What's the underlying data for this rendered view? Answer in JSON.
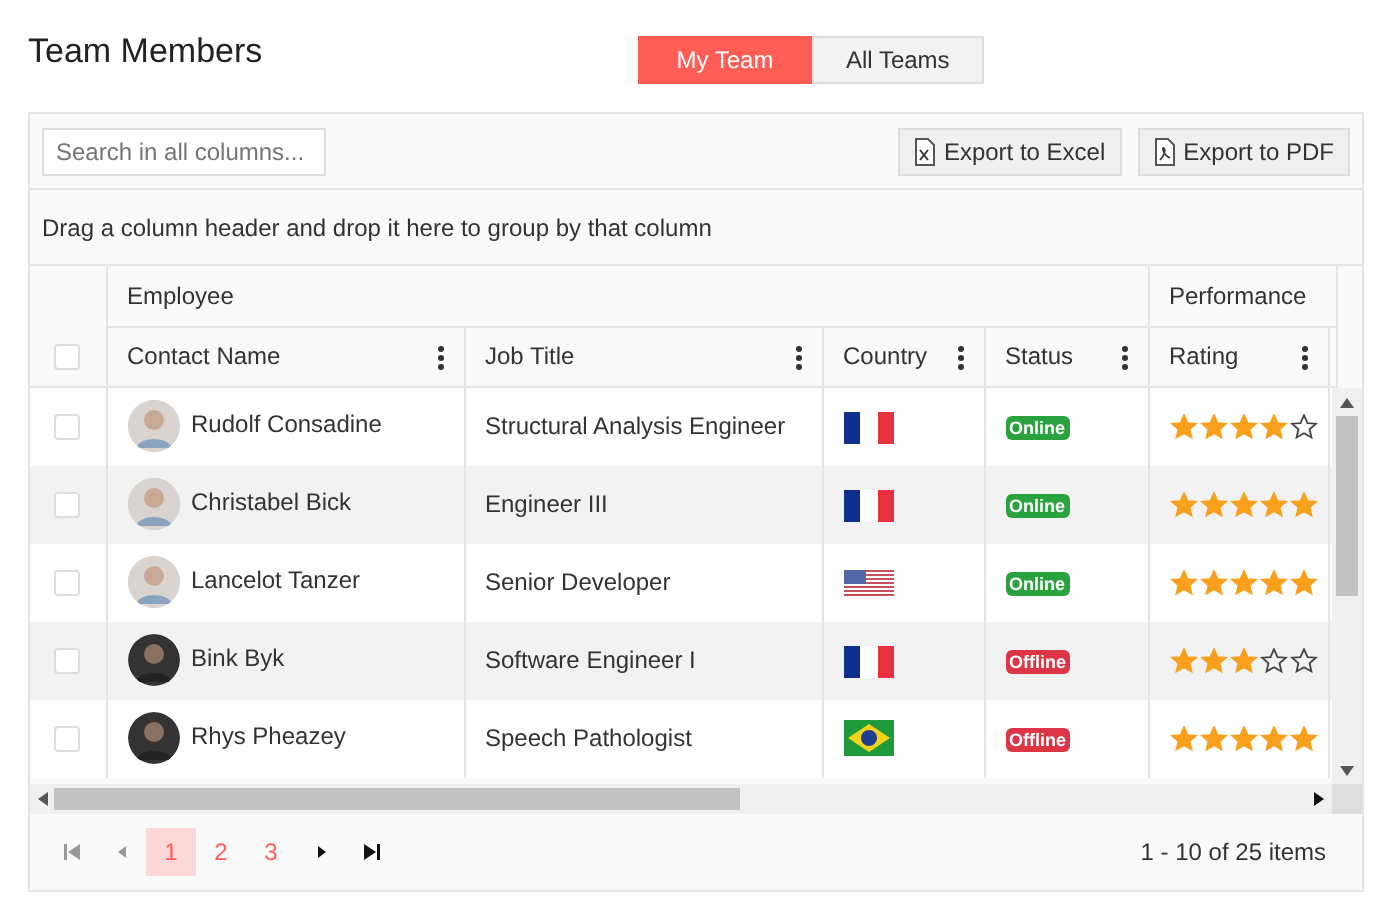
{
  "title": "Team Members",
  "view_toggle": [
    {
      "label": "My Team",
      "selected": true
    },
    {
      "label": "All Teams",
      "selected": false
    }
  ],
  "toolbar": {
    "search": {
      "placeholder": "Search in all columns..."
    },
    "buttons": [
      {
        "label": "Export to Excel",
        "kind": "excel"
      },
      {
        "label": "Export to PDF",
        "kind": "pdf"
      }
    ]
  },
  "group_panel": "Drag a column header and drop it here to group by that column",
  "column_groups": [
    "Employee",
    "Performance"
  ],
  "select_all": {
    "checked": false
  },
  "columns": [
    "Contact Name",
    "Job Title",
    "Country",
    "Status",
    "Rating"
  ],
  "rows": [
    {
      "checked": false,
      "name": "Rudolf Consadine",
      "job": "Structural Analysis Engineer",
      "kind": "france",
      "status": "Online",
      "color": "#2aa33f",
      "stars": 4
    },
    {
      "checked": false,
      "name": "Christabel Bick",
      "job": "Engineer III",
      "kind": "france",
      "status": "Online",
      "color": "#2aa33f",
      "stars": 5
    },
    {
      "checked": false,
      "name": "Lancelot Tanzer",
      "job": "Senior Developer",
      "kind": "usa",
      "status": "Online",
      "color": "#2aa33f",
      "stars": 5
    },
    {
      "checked": false,
      "name": "Bink Byk",
      "job": "Software Engineer I",
      "kind": "france",
      "status": "Offline",
      "color": "#dc3545",
      "stars": 3
    },
    {
      "checked": false,
      "name": "Rhys Pheazey",
      "job": "Speech Pathologist",
      "kind": "brazil",
      "status": "Offline",
      "color": "#dc3545",
      "stars": 5
    }
  ],
  "pager": {
    "first": {
      "disabled": true
    },
    "previous": {
      "disabled": true
    },
    "pages": [
      {
        "label": "1",
        "selected": true
      },
      {
        "label": "2",
        "selected": false
      },
      {
        "label": "3",
        "selected": false
      }
    ],
    "next": {
      "disabled": false
    },
    "last": {
      "disabled": false
    },
    "info": "1 - 10 of 25 items"
  }
}
